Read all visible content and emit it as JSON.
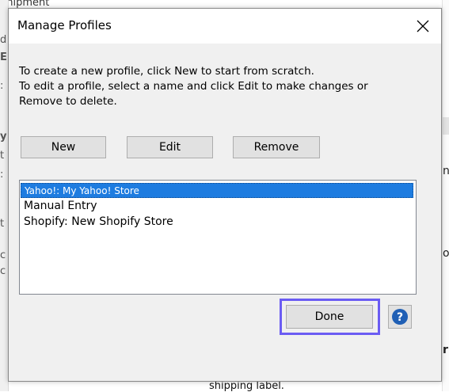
{
  "background": {
    "top_text": "Shipment",
    "left_fragments": [
      "d",
      "E",
      ":",
      "y",
      "t",
      ":",
      "t",
      "c",
      "c"
    ],
    "right_fragments": [
      "n",
      "ou",
      "rr"
    ],
    "bottom_text": "shipping label."
  },
  "dialog": {
    "title": "Manage Profiles",
    "close_icon": "close-icon",
    "instructions": [
      "To create a new profile, click New to start from scratch.",
      "To edit a profile, select a name and click Edit to make changes or",
      "Remove to delete."
    ],
    "buttons": {
      "new_label": "New",
      "edit_label": "Edit",
      "remove_label": "Remove",
      "done_label": "Done"
    },
    "profiles": [
      {
        "label": "Yahoo!: My Yahoo! Store",
        "selected": true
      },
      {
        "label": "Manual Entry",
        "selected": false
      },
      {
        "label": "Shopify: New Shopify Store",
        "selected": false
      }
    ],
    "help_icon": "help-icon",
    "colors": {
      "selection": "#1e7ce0",
      "highlight_border": "#6b5cf3",
      "help_icon": "#1f5fb5"
    }
  }
}
